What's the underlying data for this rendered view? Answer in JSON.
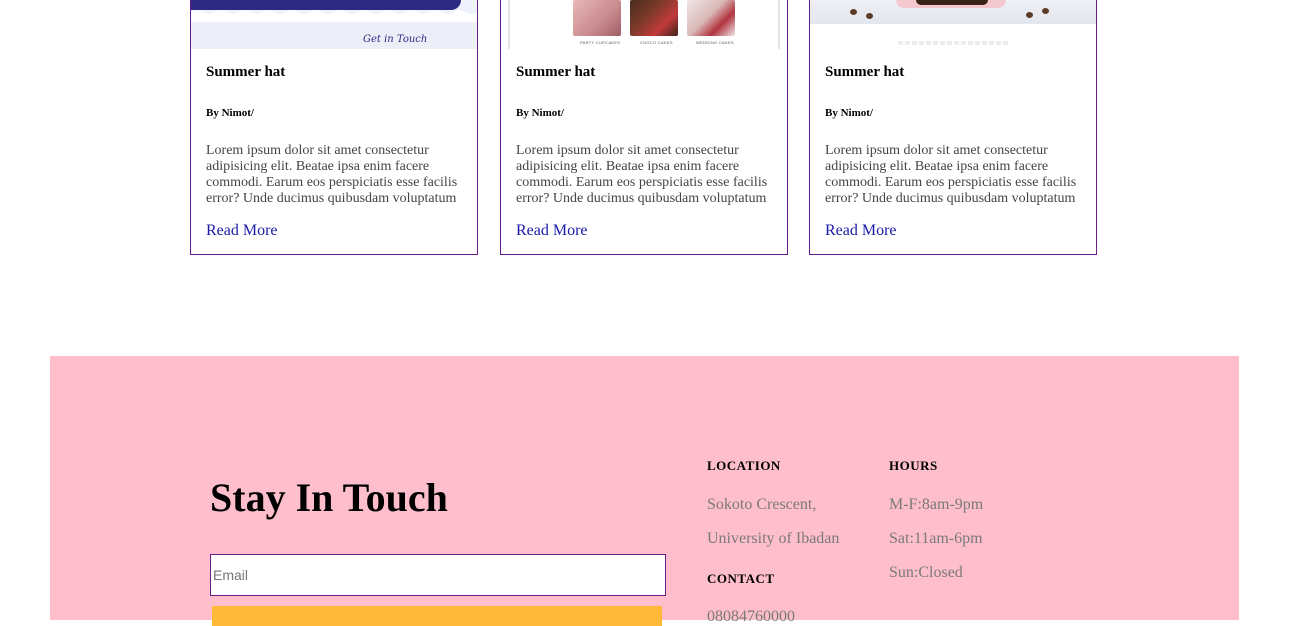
{
  "cards": [
    {
      "image": "blog-banner-get-in-touch",
      "image_caption": "Get in Touch",
      "title": "Summer hat",
      "author": "By Nimot/",
      "excerpt": "Lorem ipsum dolor sit amet consectetur adipisicing elit. Beatae ipsa enim facere commodi. Earum eos perspiciatis esse facilis error? Unde ducimus quibusdam voluptatum",
      "link": "Read More"
    },
    {
      "image": "blog-cakes-photos",
      "image_labels": [
        "PARTY CUPCAKES",
        "CHOCO CAKES",
        "WEDDING CAKES"
      ],
      "title": "Summer hat",
      "author": "By Nimot/",
      "excerpt": "Lorem ipsum dolor sit amet consectetur adipisicing elit. Beatae ipsa enim facere commodi. Earum eos perspiciatis esse facilis error? Unde ducimus quibusdam voluptatum",
      "link": "Read More"
    },
    {
      "image": "blog-chocolate-cake-photo",
      "title": "Summer hat",
      "author": "By Nimot/",
      "excerpt": "Lorem ipsum dolor sit amet consectetur adipisicing elit. Beatae ipsa enim facere commodi. Earum eos perspiciatis esse facilis error? Unde ducimus quibusdam voluptatum",
      "link": "Read More"
    }
  ],
  "footer": {
    "title": "Stay In Touch",
    "email_placeholder": "Email",
    "submit_label": "",
    "location_heading": "LOCATION",
    "location_line1": "Sokoto Crescent,",
    "location_line2": "University of Ibadan",
    "contact_heading": "CONTACT",
    "contact_phone": "08084760000",
    "hours_heading": "HOURS",
    "hours": [
      "M-F:8am-9pm",
      "Sat:11am-6pm",
      "Sun:Closed"
    ]
  },
  "colors": {
    "card_border": "#6a1b8a",
    "link": "#1a1aa6",
    "footer_bg": "#ffbecb",
    "button": "#ffb938",
    "muted_text": "#7a7a7a"
  }
}
